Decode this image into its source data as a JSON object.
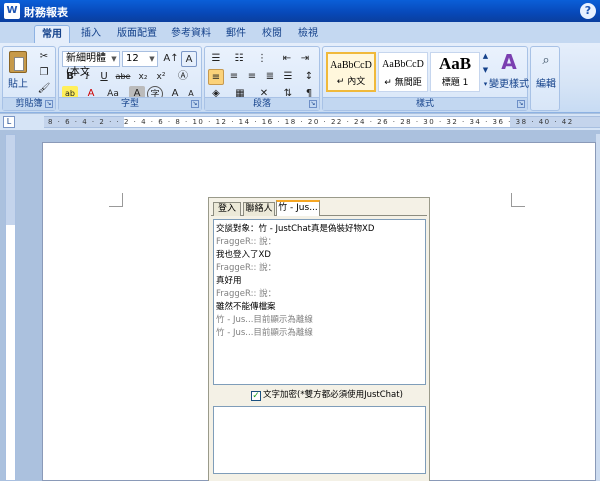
{
  "window": {
    "title": "財務報表",
    "help": "?"
  },
  "tabs": [
    {
      "label": "常用",
      "active": true
    },
    {
      "label": "插入"
    },
    {
      "label": "版面配置"
    },
    {
      "label": "參考資料"
    },
    {
      "label": "郵件"
    },
    {
      "label": "校閱"
    },
    {
      "label": "檢視"
    }
  ],
  "ribbon": {
    "clipboard": {
      "label": "剪貼簿",
      "paste": "貼上"
    },
    "font": {
      "label": "字型",
      "font_name": "新細明體 (本文",
      "font_size": "12",
      "bold": "B",
      "italic": "I",
      "underline": "U",
      "strike": "abe",
      "sub": "x₂",
      "sup": "x²",
      "clear": "Aa",
      "grow": "A",
      "shrink": "A",
      "highlight": "ab",
      "color": "A"
    },
    "paragraph": {
      "label": "段落"
    },
    "styles": {
      "label": "樣式",
      "items": [
        {
          "sample": "AaBbCcD",
          "name": "↵ 內文"
        },
        {
          "sample": "AaBbCcD",
          "name": "↵ 無間距"
        },
        {
          "sample": "AaB",
          "name": "標題 1"
        }
      ],
      "change": "變更樣式"
    },
    "editing": {
      "label": "編輯"
    }
  },
  "ruler": {
    "numbers": "8 · 6 · 4 · 2 · · 2 · 4 · 6 · 8 · 10 · 12 · 14 · 16 · 18 · 20 · 22 · 24 · 26 · 28 · 30 · 32 · 34 · 36 · 38 · 40 · 42"
  },
  "chat": {
    "tabs": [
      "登入",
      "聯絡人",
      "竹 - Jus..."
    ],
    "messages": [
      {
        "type": "text",
        "text": "交談對象：竹 - JustChat真是偽裝好物XD"
      },
      {
        "type": "sys",
        "text": "FraggeR:: 說："
      },
      {
        "type": "text",
        "text": "我也登入了XD"
      },
      {
        "type": "sys",
        "text": "FraggeR:: 說："
      },
      {
        "type": "text",
        "text": "真好用"
      },
      {
        "type": "sys",
        "text": "FraggeR:: 說："
      },
      {
        "type": "text",
        "text": "雖然不能傳檔案"
      },
      {
        "type": "sys",
        "text": "竹 - Jus...目前顯示為離線"
      },
      {
        "type": "sys",
        "text": "竹 - Jus...目前顯示為離線"
      }
    ],
    "encrypt_label": "文字加密(*雙方都必須使用JustChat)",
    "encrypt_checked": true
  }
}
